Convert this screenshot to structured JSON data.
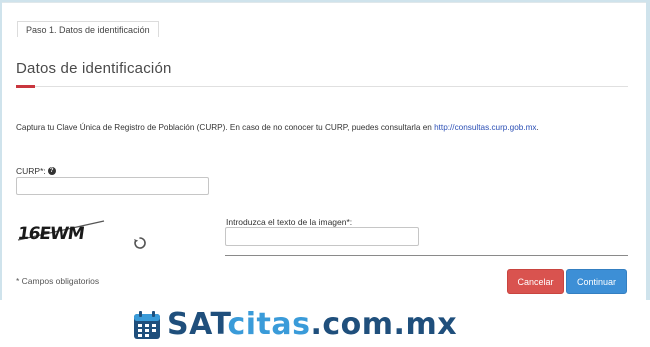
{
  "step_tab": "Paso 1. Datos de identificación",
  "section_title": "Datos de identificación",
  "instruction": {
    "text": "Captura tu Clave Única de Registro de Población (CURP). En caso de no conocer tu CURP, puedes consultarla en ",
    "link": "http://consultas.curp.gob.mx",
    "tail": "."
  },
  "curp": {
    "label": "CURP*:",
    "value": ""
  },
  "captcha": {
    "image_text": "16EWM",
    "label": "Introduzca el texto de la imagen*:",
    "value": ""
  },
  "required_note": "* Campos obligatorios",
  "buttons": {
    "cancel": "Cancelar",
    "continue": "Continuar"
  },
  "brand": {
    "part1": "SAT",
    "part2": "citas",
    "part3": ".com.mx"
  },
  "colors": {
    "accent_red": "#c9363e",
    "cancel": "#d9534f",
    "continue": "#3d8fd6",
    "link": "#2b4fb5",
    "brand_dark": "#1f4f7c",
    "brand_light": "#3a9bd9"
  },
  "icons": [
    "help-icon",
    "refresh-icon",
    "calendar-icon"
  ]
}
